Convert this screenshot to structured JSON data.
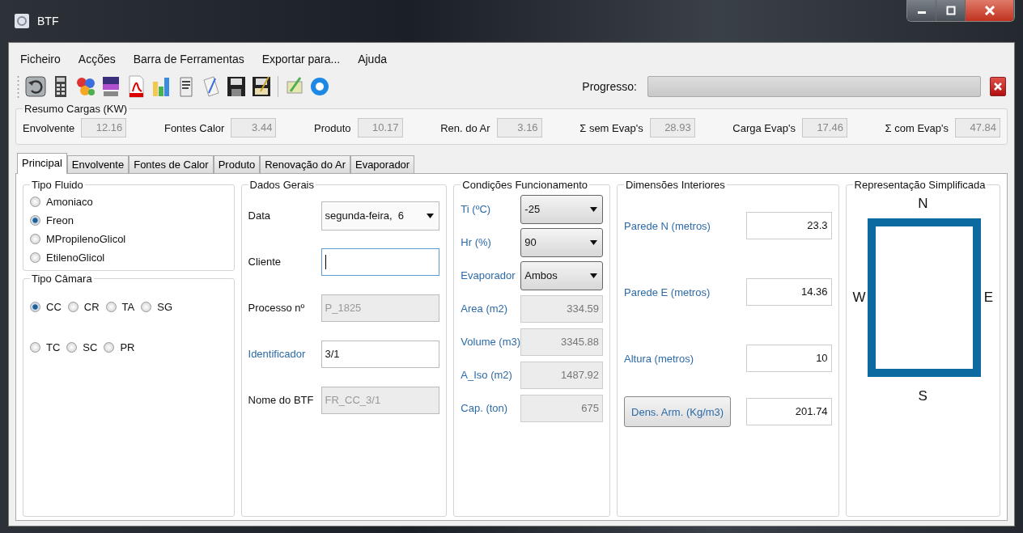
{
  "window": {
    "title": "BTF"
  },
  "menu": [
    "Ficheiro",
    "Acções",
    "Barra de Ferramentas",
    "Exportar para...",
    "Ajuda"
  ],
  "progress": {
    "label": "Progresso:",
    "level": 0
  },
  "summary": {
    "title": "Resumo Cargas (KW)",
    "items": [
      {
        "label": "Envolvente",
        "value": "12.16"
      },
      {
        "label": "Fontes Calor",
        "value": "3.44"
      },
      {
        "label": "Produto",
        "value": "10.17"
      },
      {
        "label": "Ren. do Ar",
        "value": "3.16"
      },
      {
        "label": "Σ sem Evap's",
        "value": "28.93"
      },
      {
        "label": "Carga Evap's",
        "value": "17.46"
      },
      {
        "label": "Σ com Evap's",
        "value": "47.84"
      }
    ]
  },
  "tabs": [
    {
      "label": "Principal",
      "selected": true
    },
    {
      "label": "Envolvente",
      "selected": false
    },
    {
      "label": "Fontes de Calor",
      "selected": false
    },
    {
      "label": "Produto",
      "selected": false
    },
    {
      "label": "Renovação do Ar",
      "selected": false
    },
    {
      "label": "Evaporador",
      "selected": false
    }
  ],
  "fluid": {
    "title": "Tipo Fluido",
    "options": [
      {
        "label": "Amoniaco",
        "selected": false
      },
      {
        "label": "Freon",
        "selected": true
      },
      {
        "label": "MPropilenoGlicol",
        "selected": false
      },
      {
        "label": "EtilenoGlicol",
        "selected": false
      }
    ]
  },
  "chamber": {
    "title": "Tipo Câmara",
    "rows": [
      [
        {
          "label": "CC",
          "selected": true
        },
        {
          "label": "CR",
          "selected": false
        },
        {
          "label": "TA",
          "selected": false
        },
        {
          "label": "SG",
          "selected": false
        }
      ],
      [
        {
          "label": "TC",
          "selected": false
        },
        {
          "label": "SC",
          "selected": false
        },
        {
          "label": "PR",
          "selected": false
        }
      ]
    ]
  },
  "general": {
    "title": "Dados Gerais",
    "fields": [
      {
        "label": "Data",
        "link": false,
        "kind": "dropdown",
        "value": "segunda-feira,  6",
        "focused": false
      },
      {
        "label": "Cliente",
        "link": false,
        "kind": "input",
        "focused": true
      },
      {
        "label": "Processo nº",
        "link": false,
        "kind": "readonly",
        "value": "P_1825",
        "focused": false
      },
      {
        "label": "Identificador",
        "link": true,
        "kind": "input",
        "value": "3/1",
        "focused": false
      },
      {
        "label": "Nome do BTF",
        "link": false,
        "kind": "readonly",
        "value": "FR_CC_3/1",
        "focused": false
      }
    ]
  },
  "conditions": {
    "title": "Condições Funcionamento",
    "fields": [
      {
        "label": "Ti (ºC)",
        "kind": "dropdown",
        "value": "-25"
      },
      {
        "label": "Hr (%)",
        "kind": "dropdown",
        "value": "90"
      },
      {
        "label": "Evaporador",
        "kind": "dropdown",
        "value": "Ambos"
      },
      {
        "label": "Area (m2)",
        "kind": "readonly",
        "value": "334.59"
      },
      {
        "label": "Volume (m3)",
        "kind": "readonly",
        "value": "3345.88"
      },
      {
        "label": "A_Iso (m2)",
        "kind": "readonly",
        "value": "1487.92"
      },
      {
        "label": "Cap. (ton)",
        "kind": "readonly",
        "value": "675"
      }
    ]
  },
  "dimensions": {
    "title": "Dimensões Interiores",
    "fields": [
      {
        "label": "Parede N (metros)",
        "kind": "label",
        "value": "23.3"
      },
      {
        "label": "Parede E (metros)",
        "kind": "label",
        "value": "14.36"
      },
      {
        "label": "Altura (metros)",
        "kind": "label",
        "value": "10"
      },
      {
        "label": "Dens. Arm. (Kg/m3)",
        "kind": "button",
        "value": "201.74"
      }
    ]
  },
  "diagram": {
    "title": "Representação Simplificada",
    "north": "N",
    "west": "W",
    "east": "E",
    "south": "S"
  }
}
